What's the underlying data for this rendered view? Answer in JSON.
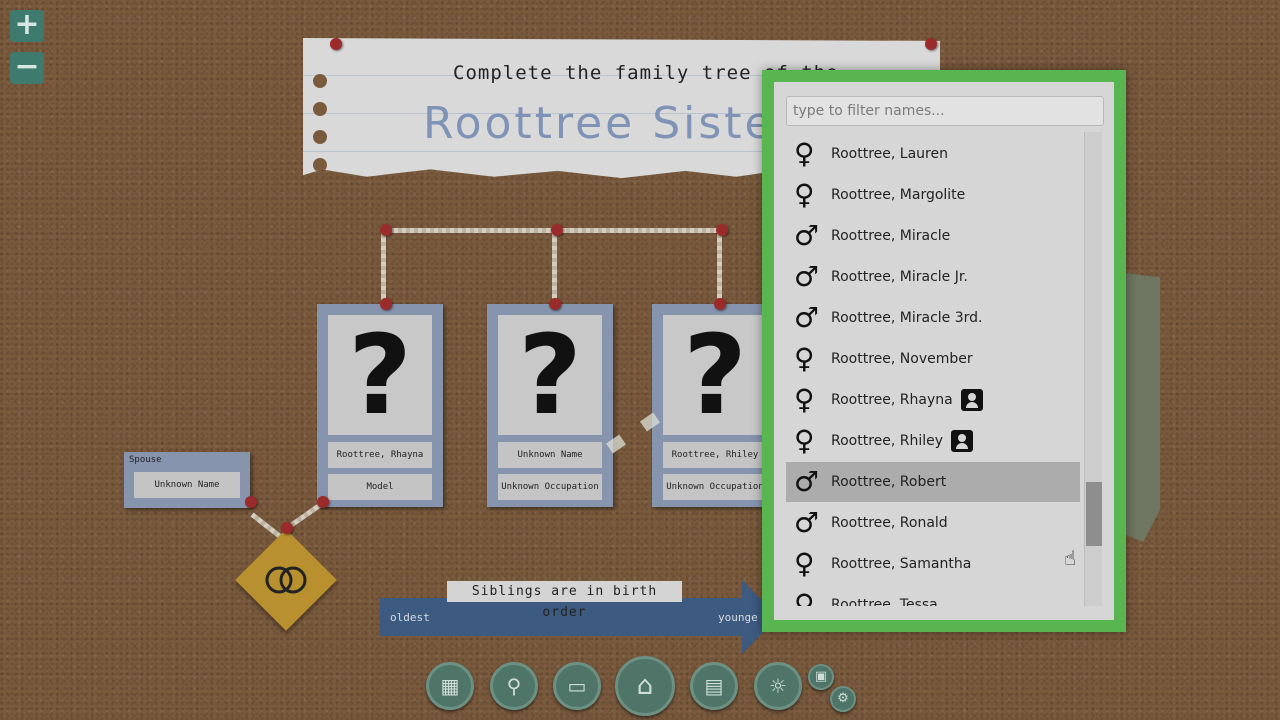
{
  "zoom": {
    "in_label": "+",
    "out_label": "−"
  },
  "title": {
    "line1": "Complete the family tree of the",
    "line2": "Roottree Siste"
  },
  "cards": [
    {
      "photo": "?",
      "name": "Roottree, Rhayna",
      "occupation": "Model"
    },
    {
      "photo": "?",
      "name": "Unknown Name",
      "occupation": "Unknown Occupation"
    },
    {
      "photo": "?",
      "name": "Roottree, Rhiley",
      "occupation": "Unknown Occupation"
    }
  ],
  "spouse": {
    "tag": "Spouse",
    "name": "Unknown Name"
  },
  "siblings": {
    "label": "Siblings are in birth order",
    "oldest": "oldest",
    "youngest": "younge"
  },
  "dropdown": {
    "placeholder": "type to filter names...",
    "items": [
      {
        "gender": "female",
        "symbol": "♀",
        "name": "Roottree, Lauren",
        "badge": false
      },
      {
        "gender": "female",
        "symbol": "♀",
        "name": "Roottree, Margolite",
        "badge": false
      },
      {
        "gender": "male",
        "symbol": "♂",
        "name": "Roottree, Miracle",
        "badge": false
      },
      {
        "gender": "male",
        "symbol": "♂",
        "name": "Roottree, Miracle Jr.",
        "badge": false
      },
      {
        "gender": "male",
        "symbol": "♂",
        "name": "Roottree, Miracle 3rd.",
        "badge": false
      },
      {
        "gender": "female",
        "symbol": "♀",
        "name": "Roottree, November",
        "badge": false
      },
      {
        "gender": "female",
        "symbol": "♀",
        "name": "Roottree, Rhayna",
        "badge": true
      },
      {
        "gender": "female",
        "symbol": "♀",
        "name": "Roottree, Rhiley",
        "badge": true
      },
      {
        "gender": "male",
        "symbol": "♂",
        "name": "Roottree, Robert",
        "badge": false,
        "selected": true
      },
      {
        "gender": "male",
        "symbol": "♂",
        "name": "Roottree, Ronald",
        "badge": false
      },
      {
        "gender": "female",
        "symbol": "♀",
        "name": "Roottree, Samantha",
        "badge": false
      },
      {
        "gender": "female",
        "symbol": "♀",
        "name": "Roottree, Tessa",
        "badge": false
      }
    ]
  },
  "toolbar": [
    {
      "name": "family-tree-icon",
      "glyph": "▦"
    },
    {
      "name": "search-person-icon",
      "glyph": "⚲"
    },
    {
      "name": "computer-icon",
      "glyph": "▭"
    },
    {
      "name": "home-icon",
      "glyph": "⌂"
    },
    {
      "name": "notebook-icon",
      "glyph": "▤"
    },
    {
      "name": "hint-icon",
      "glyph": "☼"
    },
    {
      "name": "photo-icon",
      "glyph": "▣"
    },
    {
      "name": "settings-gear-icon",
      "glyph": "⚙"
    }
  ],
  "colors": {
    "panel_border": "#58b54f",
    "card": "#8694ae",
    "cork": "#7a5a3d"
  }
}
